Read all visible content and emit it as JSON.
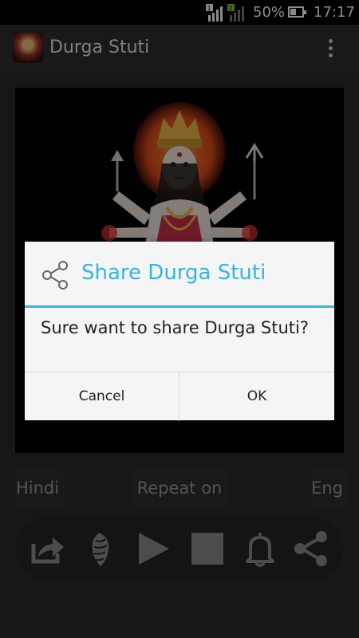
{
  "status_bar": {
    "battery_percent": "50%",
    "time": "17:17",
    "sim1_badge": "1",
    "sim2_badge": "2"
  },
  "app_bar": {
    "title": "Durga Stuti"
  },
  "buttons": {
    "hindi": "Hindi",
    "repeat": "Repeat on",
    "eng": "Eng"
  },
  "controls": [
    "open-external-icon",
    "conch-icon",
    "play-icon",
    "stop-icon",
    "bell-icon",
    "share-icon"
  ],
  "dialog": {
    "title": "Share Durga Stuti",
    "message": "Sure want to share Durga Stuti?",
    "cancel_label": "Cancel",
    "ok_label": "OK"
  },
  "colors": {
    "accent": "#33b5e5",
    "background": "#2b2b2b"
  }
}
